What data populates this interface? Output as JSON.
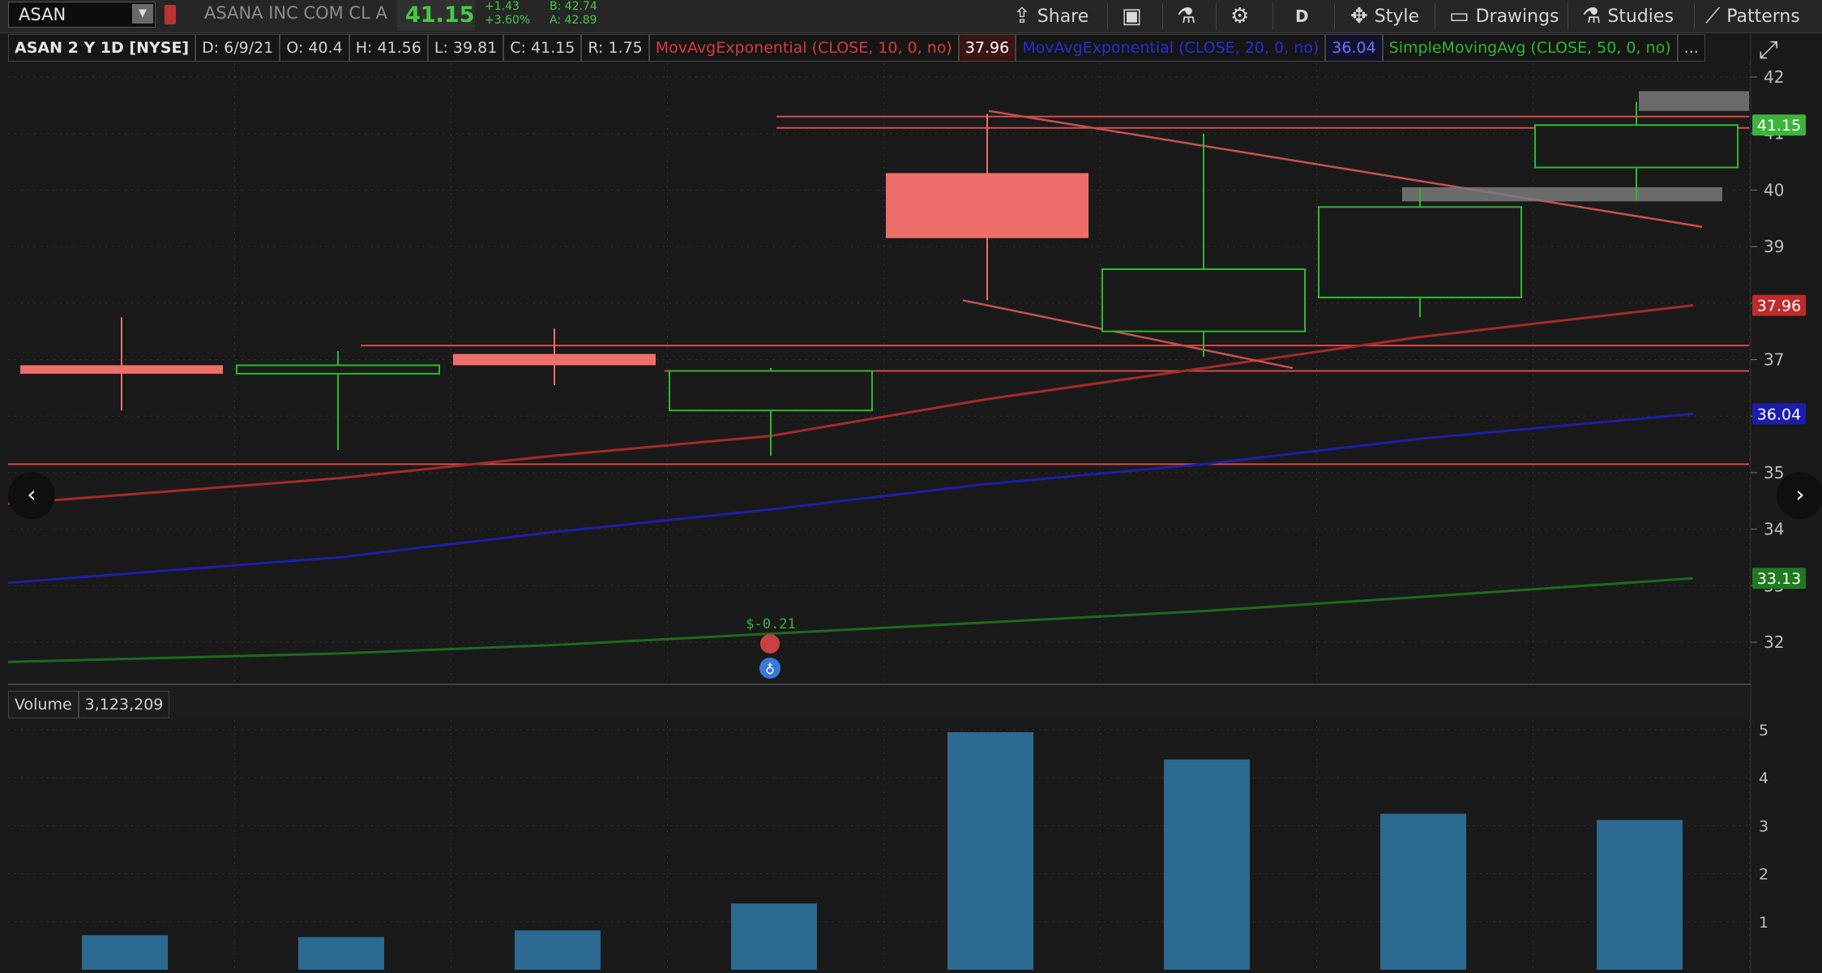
{
  "header": {
    "symbol": "ASAN",
    "company": "ASANA INC COM CL A",
    "last": "41.15",
    "change": "+1.43",
    "change_pct": "+3.60%",
    "bid": "B: 42.74",
    "ask": "A: 42.89"
  },
  "toolbar": {
    "share_label": "Share",
    "interval_label": "D",
    "style_label": "Style",
    "drawings_label": "Drawings",
    "studies_label": "Studies",
    "patterns_label": "Patterns"
  },
  "info": {
    "title": "ASAN 2 Y 1D [NYSE]",
    "date": "D: 6/9/21",
    "open": "O: 40.4",
    "high": "H: 41.56",
    "low": "L: 39.81",
    "close": "C: 41.15",
    "range": "R: 1.75",
    "study1": "MovAvgExponential (CLOSE, 10, 0, no)",
    "study1_value": "37.96",
    "study2": "MovAvgExponential (CLOSE, 20, 0, no)",
    "study2_value": "36.04",
    "study3": "SimpleMovingAvg (CLOSE, 50, 0, no)",
    "more": "..."
  },
  "volume": {
    "label": "Volume",
    "value": "3,123,209"
  },
  "colors": {
    "up": "#2db82d",
    "down": "#ee6e6a",
    "ema10": "#a52a2a",
    "ema20": "#1f1fa8",
    "sma50": "#1c6b1c",
    "hline": "#d84a4a",
    "volume": "#2c6a92"
  },
  "earnings_marker": "$-0.21",
  "chart_data": {
    "type": "candlestick",
    "price_axis": {
      "min": 31.5,
      "max": 42.2,
      "ticks": [
        32,
        33,
        34,
        35,
        36,
        37,
        38,
        39,
        40,
        41,
        42
      ]
    },
    "candles": [
      {
        "open": 36.9,
        "high": 37.75,
        "low": 36.1,
        "close": 36.75,
        "dir": "down"
      },
      {
        "open": 36.75,
        "high": 37.15,
        "low": 35.4,
        "close": 36.9,
        "dir": "up"
      },
      {
        "open": 37.1,
        "high": 37.55,
        "low": 36.55,
        "close": 36.9,
        "dir": "down"
      },
      {
        "open": 36.1,
        "high": 36.85,
        "low": 35.3,
        "close": 36.8,
        "dir": "up"
      },
      {
        "open": 40.3,
        "high": 41.35,
        "low": 38.05,
        "close": 39.15,
        "dir": "down"
      },
      {
        "open": 37.5,
        "high": 41.0,
        "low": 37.05,
        "close": 38.6,
        "dir": "up"
      },
      {
        "open": 38.1,
        "high": 40.05,
        "low": 37.75,
        "close": 39.7,
        "dir": "up"
      },
      {
        "open": 40.4,
        "high": 41.56,
        "low": 39.81,
        "close": 41.15,
        "dir": "up"
      }
    ],
    "ema10": [
      34.45,
      34.9,
      35.3,
      35.65,
      36.3,
      36.85,
      37.4,
      37.96
    ],
    "ema20": [
      33.05,
      33.5,
      33.95,
      34.35,
      34.8,
      35.15,
      35.6,
      36.04
    ],
    "sma50": [
      31.65,
      31.8,
      31.95,
      32.15,
      32.35,
      32.55,
      32.8,
      33.13
    ],
    "horizontal_lines": [
      41.3,
      41.1,
      37.25,
      36.8,
      35.15
    ],
    "price_labels": [
      {
        "value": "41.15",
        "color": "#3cb43c"
      },
      {
        "value": "37.96",
        "color": "#c02a2a"
      },
      {
        "value": "36.04",
        "color": "#1c1cb0"
      },
      {
        "value": "33.13",
        "color": "#1f7a1f"
      }
    ],
    "volume_axis": {
      "min": 0,
      "max": 5,
      "ticks": [
        1,
        2,
        3,
        4,
        5
      ]
    },
    "volumes": [
      0.72,
      0.68,
      0.82,
      1.38,
      4.95,
      4.38,
      3.25,
      3.12
    ]
  }
}
